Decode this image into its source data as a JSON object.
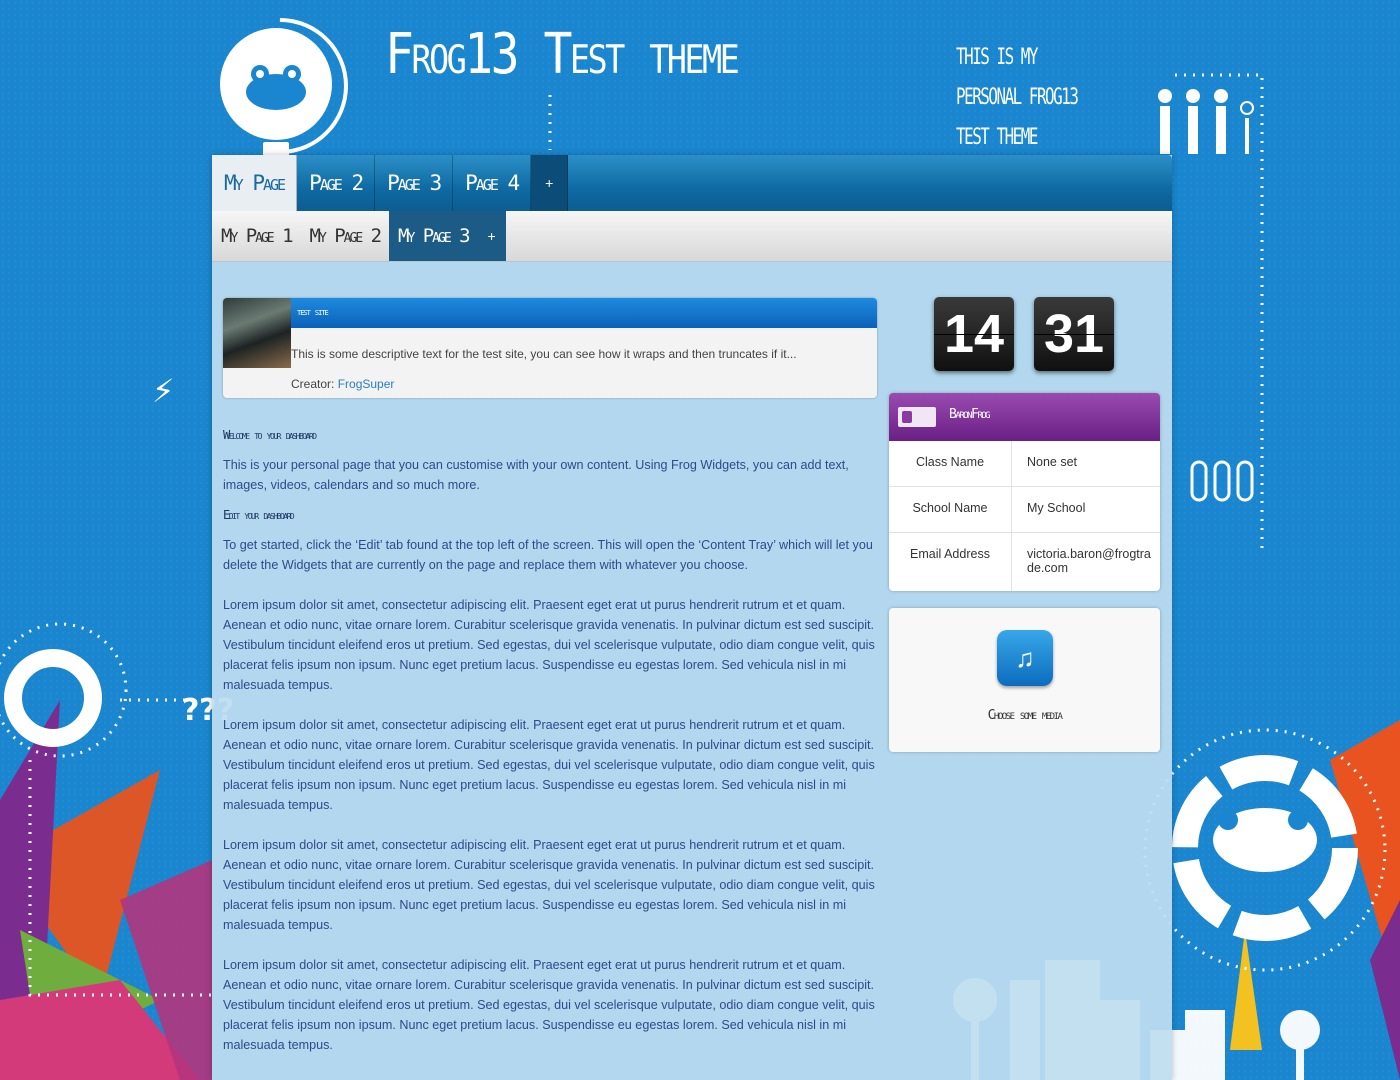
{
  "header": {
    "site_title": "Frog13 Test theme",
    "tagline": "This is my personal Frog13 test theme"
  },
  "nav": {
    "tabs": [
      {
        "label": "My Page"
      },
      {
        "label": "Page 2"
      },
      {
        "label": "Page 3"
      },
      {
        "label": "Page 4"
      },
      {
        "label": "+"
      }
    ],
    "subtabs": [
      {
        "label": "My Page 1"
      },
      {
        "label": "My Page 2"
      },
      {
        "label": "My Page 3"
      },
      {
        "label": "+"
      }
    ]
  },
  "site_card": {
    "title": "test site",
    "description": "This is some descriptive text for the test site, you can see how it wraps and then truncates if it...",
    "creator_label": "Creator:",
    "creator_name": "FrogSuper"
  },
  "content": {
    "heading_welcome": "Welcome to your dashboard",
    "welcome_text": "This is your personal page that you can customise with your own content. Using Frog Widgets, you can add text, images, videos, calendars and so much more.",
    "heading_edit": "Edit your dashboard",
    "edit_text": "To get started, click the ‘Edit’ tab found at the top left of the screen. This will open the ‘Content Tray’ which will let you delete the Widgets that are currently on the page and replace them with whatever you choose.",
    "lorem": [
      "Lorem ipsum dolor sit amet, consectetur adipiscing elit. Praesent eget erat ut purus hendrerit rutrum et et quam. Aenean et odio nunc, vitae ornare lorem. Curabitur scelerisque gravida venenatis. In pulvinar dictum est sed suscipit. Vestibulum tincidunt eleifend eros ut pretium. Sed egestas, dui vel scelerisque vulputate, odio diam congue velit, quis placerat felis ipsum non ipsum. Nunc eget pretium lacus. Suspendisse eu egestas lorem. Sed vehicula nisl in mi malesuada tempus.",
      "Lorem ipsum dolor sit amet, consectetur adipiscing elit. Praesent eget erat ut purus hendrerit rutrum et et quam. Aenean et odio nunc, vitae ornare lorem. Curabitur scelerisque gravida venenatis. In pulvinar dictum est sed suscipit. Vestibulum tincidunt eleifend eros ut pretium. Sed egestas, dui vel scelerisque vulputate, odio diam congue velit, quis placerat felis ipsum non ipsum. Nunc eget pretium lacus. Suspendisse eu egestas lorem. Sed vehicula nisl in mi malesuada tempus.",
      "Lorem ipsum dolor sit amet, consectetur adipiscing elit. Praesent eget erat ut purus hendrerit rutrum et et quam. Aenean et odio nunc, vitae ornare lorem. Curabitur scelerisque gravida venenatis. In pulvinar dictum est sed suscipit. Vestibulum tincidunt eleifend eros ut pretium. Sed egestas, dui vel scelerisque vulputate, odio diam congue velit, quis placerat felis ipsum non ipsum. Nunc eget pretium lacus. Suspendisse eu egestas lorem. Sed vehicula nisl in mi malesuada tempus.",
      "Lorem ipsum dolor sit amet, consectetur adipiscing elit. Praesent eget erat ut purus hendrerit rutrum et et quam. Aenean et odio nunc, vitae ornare lorem. Curabitur scelerisque gravida venenatis. In pulvinar dictum est sed suscipit. Vestibulum tincidunt eleifend eros ut pretium. Sed egestas, dui vel scelerisque vulputate, odio diam congue velit, quis placerat felis ipsum non ipsum. Nunc eget pretium lacus. Suspendisse eu egestas lorem. Sed vehicula nisl in mi malesuada tempus."
    ]
  },
  "clock": {
    "hours": "14",
    "minutes": "31"
  },
  "profile": {
    "name": "BaronFrog",
    "rows": [
      {
        "label": "Class Name",
        "value": "None set"
      },
      {
        "label": "School Name",
        "value": "My School"
      },
      {
        "label": "Email Address",
        "value": "victoria.baron@frogtrade.com"
      }
    ]
  },
  "media": {
    "label": "Choose some media",
    "icon": "media-icon"
  },
  "colors": {
    "background": "#1a86cf",
    "tabbar": "#0f6aa3",
    "site_header": "#0a62b8",
    "profile_header": "#7c2c96",
    "link": "#2a7bd0"
  }
}
